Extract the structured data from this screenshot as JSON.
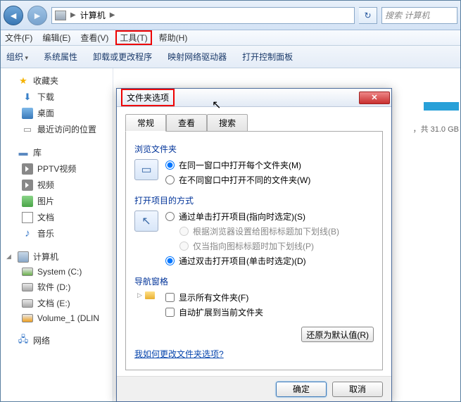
{
  "address": {
    "location": "计算机"
  },
  "search": {
    "placeholder": "搜索 计算机"
  },
  "menu": {
    "file": "文件(F)",
    "edit": "编辑(E)",
    "view": "查看(V)",
    "tools": "工具(T)",
    "help": "帮助(H)"
  },
  "toolbar": {
    "organize": "组织",
    "sysprops": "系统属性",
    "uninstall": "卸载或更改程序",
    "mapdrive": "映射网络驱动器",
    "controlpanel": "打开控制面板"
  },
  "sidebar": {
    "favorites": {
      "label": "收藏夹",
      "items": [
        "下载",
        "桌面",
        "最近访问的位置"
      ]
    },
    "libraries": {
      "label": "库",
      "items": [
        "PPTV视频",
        "视频",
        "图片",
        "文档",
        "音乐"
      ]
    },
    "computer": {
      "label": "计算机",
      "items": [
        "System (C:)",
        "软件 (D:)",
        "文档 (E:)",
        "Volume_1 (DLIN"
      ]
    },
    "network": {
      "label": "网络"
    }
  },
  "content": {
    "disk_info": "，共 31.0 GB"
  },
  "dialog": {
    "title": "文件夹选项",
    "tabs": {
      "general": "常规",
      "view": "查看",
      "search": "搜索"
    },
    "browse": {
      "title": "浏览文件夹",
      "same": "在同一窗口中打开每个文件夹(M)",
      "own": "在不同窗口中打开不同的文件夹(W)"
    },
    "click": {
      "title": "打开项目的方式",
      "single": "通过单击打开项目(指向时选定)(S)",
      "under_browser": "根据浏览器设置给图标标题加下划线(B)",
      "under_point": "仅当指向图标标题时加下划线(P)",
      "double": "通过双击打开项目(单击时选定)(D)"
    },
    "nav": {
      "title": "导航窗格",
      "showall": "显示所有文件夹(F)",
      "autoexp": "自动扩展到当前文件夹"
    },
    "restore": "还原为默认值(R)",
    "link": "我如何更改文件夹选项?",
    "ok": "确定",
    "cancel": "取消"
  }
}
